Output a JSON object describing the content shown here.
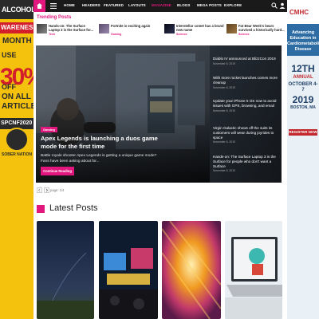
{
  "ad_left": {
    "line1": "ALCOHOL",
    "line2": "WARENESS",
    "line3": "MONTH",
    "percent": "30%",
    "off": "OFF",
    "line5": "ON ALL",
    "line6": "ARTICLES",
    "line7": "USE",
    "code": "SPCNF2020",
    "sponsor": "SOBER NATION"
  },
  "ad_right": {
    "brand": "CMHC",
    "tagline": "Advancing Education in Cardiometabolic Disease",
    "day": "12TH",
    "annual": "ANNUAL",
    "dates": "OCTOBER 4-7",
    "year": "2019",
    "location": "BOSTON, MA",
    "register": "REGISTER NOW"
  },
  "nav": {
    "items": [
      "HOME",
      "HEADERS",
      "FEATURED",
      "LAYOUTS",
      "MAGAZINE",
      "BLOGS",
      "MEGA POSTS",
      "EXPLORE"
    ],
    "active": "MAGAZINE"
  },
  "trending": {
    "title": "Trending Posts",
    "items": [
      {
        "title": "Hands-on: The Surface Laptop 3 is the Surface for...",
        "category": "Tech"
      },
      {
        "title": "Fortnite is exciting again",
        "category": "Gaming"
      },
      {
        "title": "Interstellar comet has a brand new name",
        "category": "Science"
      },
      {
        "title": "Fat Bear Week's bears survived a historically hard...",
        "category": "Science"
      }
    ]
  },
  "hero": {
    "badge": "Gaming",
    "title": "Apex Legends is launching a duos game mode for the first time",
    "excerpt": "Battle royale shooter Apex Legends is getting a unique game mode? Fans have been asking about for...",
    "button": "Continue Reading"
  },
  "side_list": [
    {
      "title": "Diablo IV announced at BlizzCon 2019",
      "date": "November 8, 2019"
    },
    {
      "title": "With more rocket launches comes more cleanup",
      "date": "November 8, 2019"
    },
    {
      "title": "Update your iPhone 5 OS now to avoid issues with GPS, browsing, and email",
      "date": "November 8, 2019"
    },
    {
      "title": "Virgin Galactic shows off the suits its customers will wear during joyrides to space",
      "date": "November 8, 2019"
    },
    {
      "title": "Hands-on: The Surface Laptop 3 is the Surface for people who don't want a Surface",
      "date": "November 8, 2019"
    }
  ],
  "pager": {
    "info": "page: 1/4"
  },
  "latest": {
    "title": "Latest Posts"
  },
  "colors": {
    "accent": "#e2177d",
    "nav_bg": "#1a1a1a"
  }
}
